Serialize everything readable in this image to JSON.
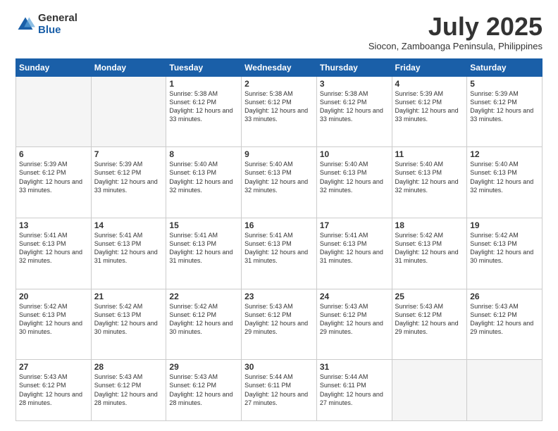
{
  "logo": {
    "general": "General",
    "blue": "Blue"
  },
  "title": "July 2025",
  "subtitle": "Siocon, Zamboanga Peninsula, Philippines",
  "days_of_week": [
    "Sunday",
    "Monday",
    "Tuesday",
    "Wednesday",
    "Thursday",
    "Friday",
    "Saturday"
  ],
  "weeks": [
    [
      {
        "day": "",
        "info": ""
      },
      {
        "day": "",
        "info": ""
      },
      {
        "day": "1",
        "info": "Sunrise: 5:38 AM\nSunset: 6:12 PM\nDaylight: 12 hours and 33 minutes."
      },
      {
        "day": "2",
        "info": "Sunrise: 5:38 AM\nSunset: 6:12 PM\nDaylight: 12 hours and 33 minutes."
      },
      {
        "day": "3",
        "info": "Sunrise: 5:38 AM\nSunset: 6:12 PM\nDaylight: 12 hours and 33 minutes."
      },
      {
        "day": "4",
        "info": "Sunrise: 5:39 AM\nSunset: 6:12 PM\nDaylight: 12 hours and 33 minutes."
      },
      {
        "day": "5",
        "info": "Sunrise: 5:39 AM\nSunset: 6:12 PM\nDaylight: 12 hours and 33 minutes."
      }
    ],
    [
      {
        "day": "6",
        "info": "Sunrise: 5:39 AM\nSunset: 6:12 PM\nDaylight: 12 hours and 33 minutes."
      },
      {
        "day": "7",
        "info": "Sunrise: 5:39 AM\nSunset: 6:12 PM\nDaylight: 12 hours and 33 minutes."
      },
      {
        "day": "8",
        "info": "Sunrise: 5:40 AM\nSunset: 6:13 PM\nDaylight: 12 hours and 32 minutes."
      },
      {
        "day": "9",
        "info": "Sunrise: 5:40 AM\nSunset: 6:13 PM\nDaylight: 12 hours and 32 minutes."
      },
      {
        "day": "10",
        "info": "Sunrise: 5:40 AM\nSunset: 6:13 PM\nDaylight: 12 hours and 32 minutes."
      },
      {
        "day": "11",
        "info": "Sunrise: 5:40 AM\nSunset: 6:13 PM\nDaylight: 12 hours and 32 minutes."
      },
      {
        "day": "12",
        "info": "Sunrise: 5:40 AM\nSunset: 6:13 PM\nDaylight: 12 hours and 32 minutes."
      }
    ],
    [
      {
        "day": "13",
        "info": "Sunrise: 5:41 AM\nSunset: 6:13 PM\nDaylight: 12 hours and 32 minutes."
      },
      {
        "day": "14",
        "info": "Sunrise: 5:41 AM\nSunset: 6:13 PM\nDaylight: 12 hours and 31 minutes."
      },
      {
        "day": "15",
        "info": "Sunrise: 5:41 AM\nSunset: 6:13 PM\nDaylight: 12 hours and 31 minutes."
      },
      {
        "day": "16",
        "info": "Sunrise: 5:41 AM\nSunset: 6:13 PM\nDaylight: 12 hours and 31 minutes."
      },
      {
        "day": "17",
        "info": "Sunrise: 5:41 AM\nSunset: 6:13 PM\nDaylight: 12 hours and 31 minutes."
      },
      {
        "day": "18",
        "info": "Sunrise: 5:42 AM\nSunset: 6:13 PM\nDaylight: 12 hours and 31 minutes."
      },
      {
        "day": "19",
        "info": "Sunrise: 5:42 AM\nSunset: 6:13 PM\nDaylight: 12 hours and 30 minutes."
      }
    ],
    [
      {
        "day": "20",
        "info": "Sunrise: 5:42 AM\nSunset: 6:13 PM\nDaylight: 12 hours and 30 minutes."
      },
      {
        "day": "21",
        "info": "Sunrise: 5:42 AM\nSunset: 6:13 PM\nDaylight: 12 hours and 30 minutes."
      },
      {
        "day": "22",
        "info": "Sunrise: 5:42 AM\nSunset: 6:12 PM\nDaylight: 12 hours and 30 minutes."
      },
      {
        "day": "23",
        "info": "Sunrise: 5:43 AM\nSunset: 6:12 PM\nDaylight: 12 hours and 29 minutes."
      },
      {
        "day": "24",
        "info": "Sunrise: 5:43 AM\nSunset: 6:12 PM\nDaylight: 12 hours and 29 minutes."
      },
      {
        "day": "25",
        "info": "Sunrise: 5:43 AM\nSunset: 6:12 PM\nDaylight: 12 hours and 29 minutes."
      },
      {
        "day": "26",
        "info": "Sunrise: 5:43 AM\nSunset: 6:12 PM\nDaylight: 12 hours and 29 minutes."
      }
    ],
    [
      {
        "day": "27",
        "info": "Sunrise: 5:43 AM\nSunset: 6:12 PM\nDaylight: 12 hours and 28 minutes."
      },
      {
        "day": "28",
        "info": "Sunrise: 5:43 AM\nSunset: 6:12 PM\nDaylight: 12 hours and 28 minutes."
      },
      {
        "day": "29",
        "info": "Sunrise: 5:43 AM\nSunset: 6:12 PM\nDaylight: 12 hours and 28 minutes."
      },
      {
        "day": "30",
        "info": "Sunrise: 5:44 AM\nSunset: 6:11 PM\nDaylight: 12 hours and 27 minutes."
      },
      {
        "day": "31",
        "info": "Sunrise: 5:44 AM\nSunset: 6:11 PM\nDaylight: 12 hours and 27 minutes."
      },
      {
        "day": "",
        "info": ""
      },
      {
        "day": "",
        "info": ""
      }
    ]
  ]
}
